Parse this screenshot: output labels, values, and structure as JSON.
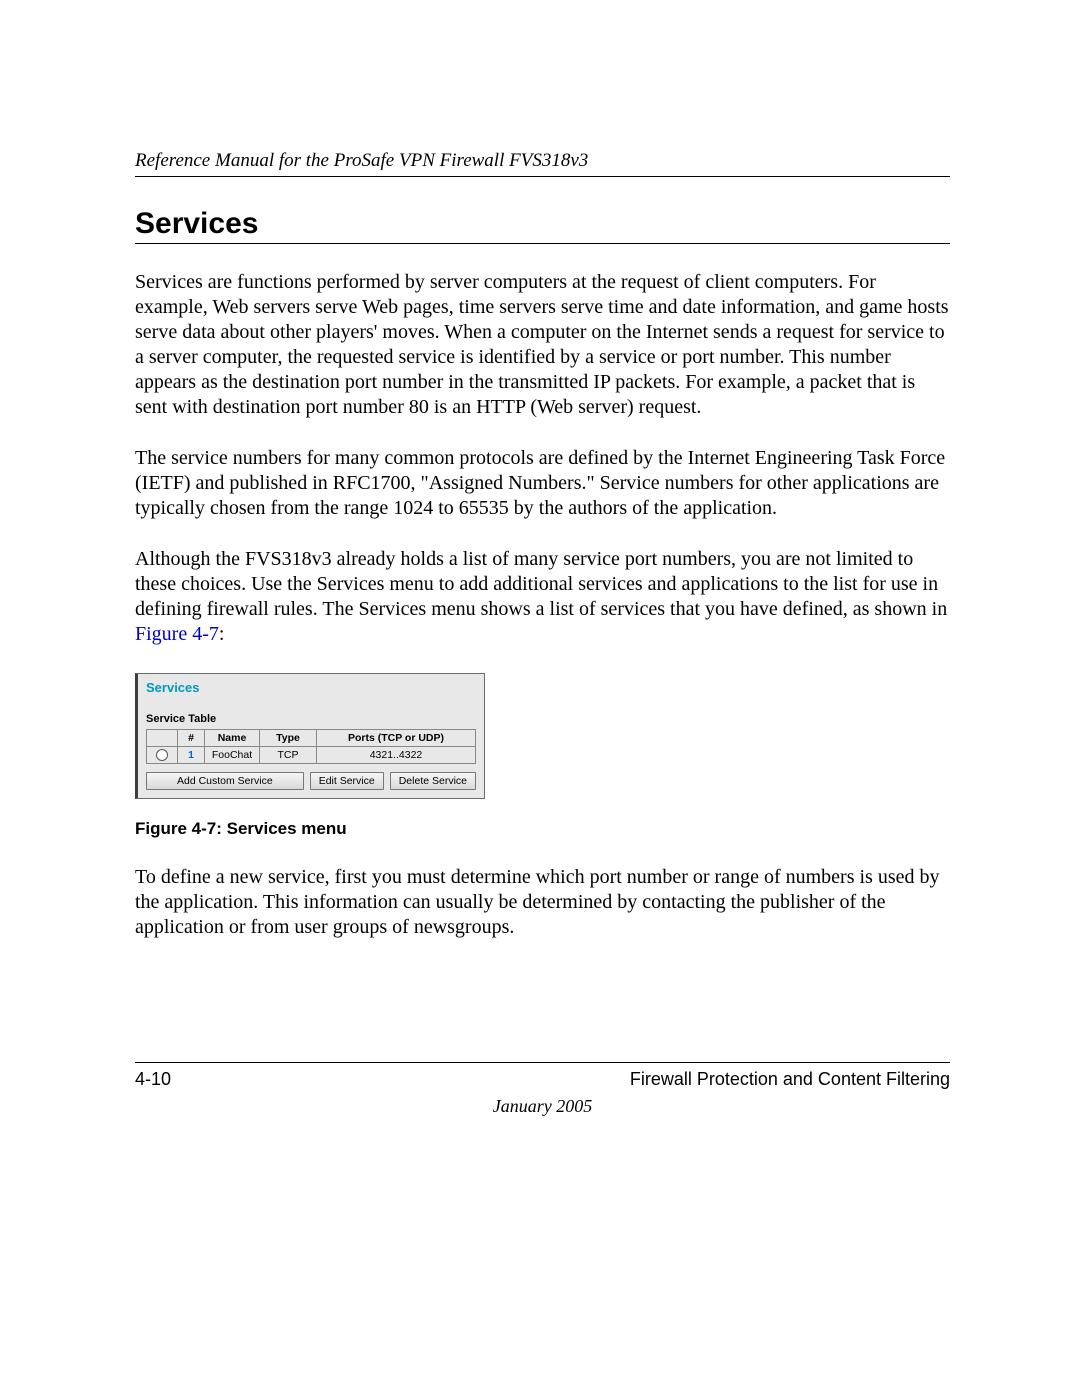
{
  "header": {
    "running_head": "Reference Manual for the ProSafe VPN Firewall FVS318v3"
  },
  "section": {
    "title": "Services",
    "para1": "Services are functions performed by server computers at the request of client computers. For example, Web servers serve Web pages, time servers serve time and date information, and game hosts serve data about other players' moves. When a computer on the Internet sends a request for service to a server computer, the requested service is identified by a service or port number. This number appears as the destination port number in the transmitted IP packets. For example, a packet that is sent with destination port number 80 is an HTTP (Web server) request.",
    "para2": "The service numbers for many common protocols are defined by the Internet Engineering Task Force (IETF) and published in RFC1700, \"Assigned Numbers.\" Service numbers for other applications are typically chosen from the range 1024 to 65535 by the authors of the application.",
    "para3_prefix": "Although the FVS318v3 already holds a list of many service port numbers, you are not limited to these choices. Use the Services menu to add additional services and applications to the list for use in defining firewall rules. The Services menu shows a list of services that you have defined, as shown in ",
    "para3_figref": "Figure 4-7",
    "para3_suffix": ":",
    "para4": "To define a new service, first you must determine which port number or range of numbers is used by the application. This information can usually be determined by contacting the publisher of the application or from user groups of newsgroups."
  },
  "figure": {
    "panel_title": "Services",
    "subhead": "Service Table",
    "columns": {
      "c1": "#",
      "c2": "Name",
      "c3": "Type",
      "c4": "Ports (TCP or UDP)"
    },
    "row": {
      "idx": "1",
      "name": "FooChat",
      "type": "TCP",
      "ports": "4321..4322"
    },
    "buttons": {
      "add": "Add Custom Service",
      "edit": "Edit Service",
      "del": "Delete Service"
    },
    "caption": "Figure 4-7:  Services menu"
  },
  "footer": {
    "page_number": "4-10",
    "chapter": "Firewall Protection and Content Filtering",
    "date": "January 2005"
  }
}
